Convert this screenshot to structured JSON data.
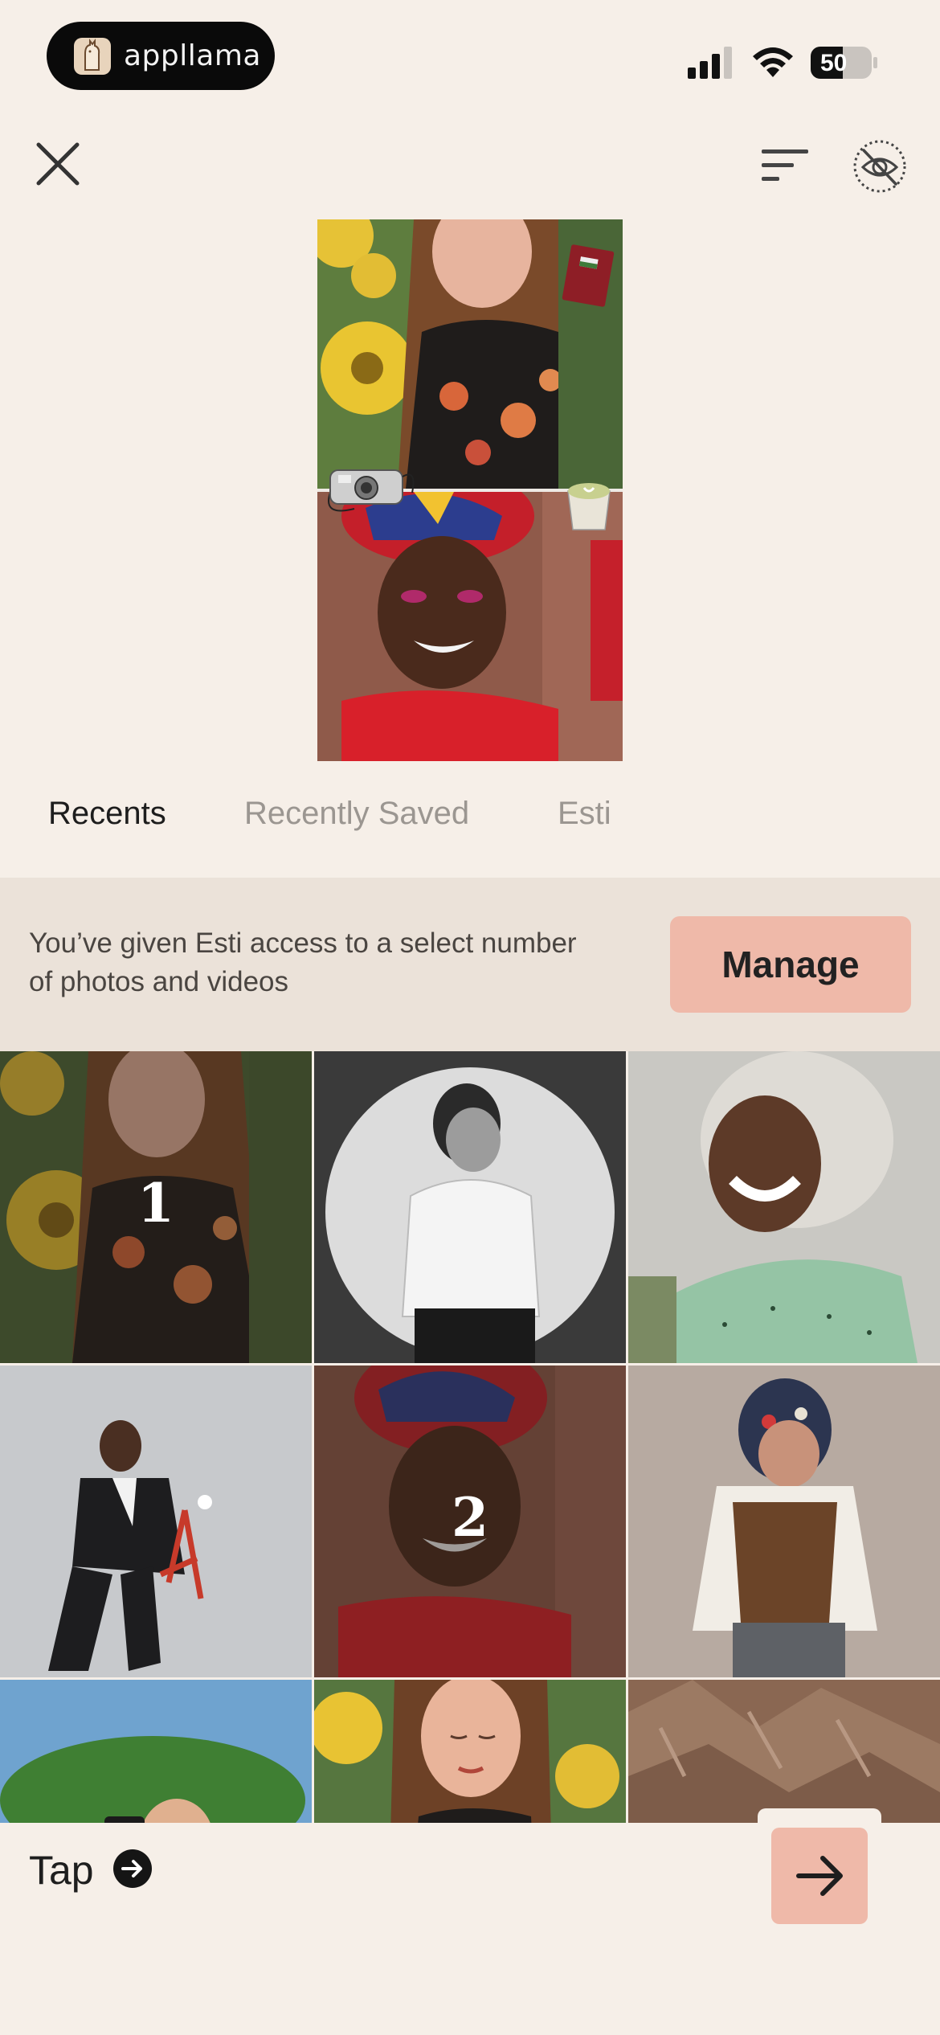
{
  "status_bar": {
    "brand_name": "appllama",
    "battery_level": "50",
    "icons": [
      "brand-llama-logo",
      "signal-icon",
      "wifi-icon",
      "battery-icon"
    ]
  },
  "toolbar": {
    "icons": [
      "close-icon",
      "sort-icon",
      "eye-off-icon"
    ]
  },
  "tabs": [
    {
      "label": "Recents",
      "active": true
    },
    {
      "label": "Recently Saved",
      "active": false
    },
    {
      "label": "Esti",
      "active": false
    }
  ],
  "access_banner": {
    "message": "You’ve given Esti access to a select number of photos and videos",
    "manage_label": "Manage"
  },
  "photos": [
    {
      "subject": "woman-sunflowers",
      "selected_index": "1"
    },
    {
      "subject": "man-white-shirt-bw",
      "selected_index": null
    },
    {
      "subject": "smiling-woman-curly-grey-hair",
      "selected_index": null
    },
    {
      "subject": "woman-red-chair",
      "selected_index": null
    },
    {
      "subject": "woman-headwrap",
      "selected_index": "2"
    },
    {
      "subject": "woman-headscarf-vest",
      "selected_index": null
    },
    {
      "subject": "woman-camera-trees",
      "selected_index": null
    },
    {
      "subject": "woman-sunflowers-eyes-closed",
      "selected_index": null
    },
    {
      "subject": "rocky-landscape",
      "selected_index": null
    }
  ],
  "bottom": {
    "tap_label": "Tap",
    "tap_icon": "arrow-right-circle-icon",
    "next_icon": "arrow-right-icon"
  },
  "colors": {
    "background": "#f6efe8",
    "banner": "#ebe2d9",
    "accent": "#efb9a9",
    "tab_inactive": "#9b9691"
  }
}
